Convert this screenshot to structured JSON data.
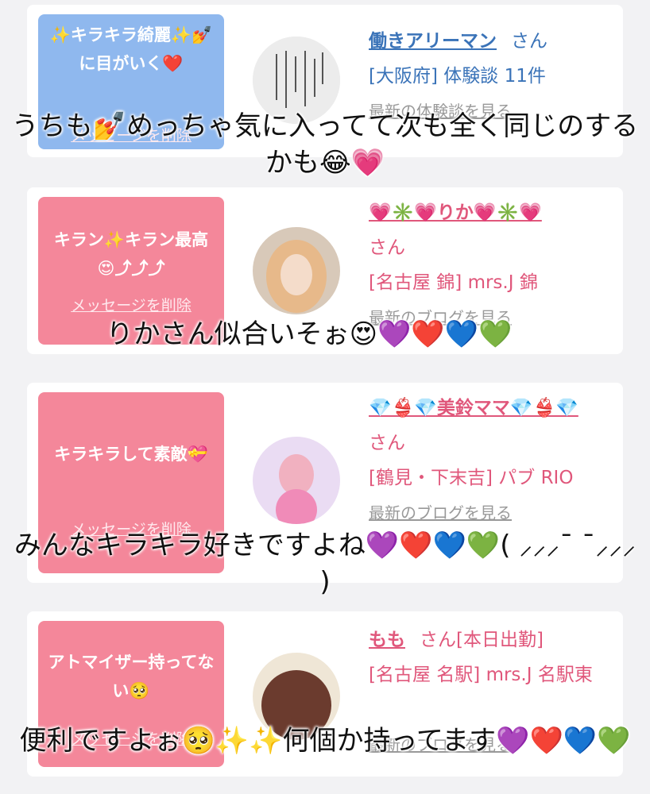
{
  "cards": [
    {
      "bubble": "✨キラキラ綺麗✨💅に目がいく❤️",
      "delete_label": "メッセージを削除",
      "name": "働きアリーマン",
      "san": "さん",
      "meta": "[大阪府] 体験談 11件",
      "blog": "最新の体験談を見る",
      "accent": "#8fb8ee"
    },
    {
      "bubble": "キラン✨キラン最高😍⤴⤴⤴",
      "delete_label": "メッセージを削除",
      "name": "💗✳️💗りか💗✳️💗",
      "san": "さん",
      "meta": "[名古屋 錦] mrs.J 錦",
      "blog": "最新のブログを見る",
      "accent": "#f4879a"
    },
    {
      "bubble": "キラキラして素敵💝",
      "delete_label": "メッセージを削除",
      "name": "💎👙💎美鈴ママ💎👙💎",
      "san": "さん",
      "meta": "[鶴見・下末吉] パブ RIO",
      "blog": "最新のブログを見る",
      "accent": "#f4879a"
    },
    {
      "bubble": "アトマイザー持ってない🥺",
      "delete_label": "メッセージを削除",
      "name": "もも",
      "san": "さん[本日出勤]",
      "meta": "[名古屋 名駅] mrs.J 名駅東",
      "blog": "最新のブログを見る",
      "accent": "#f4879a"
    }
  ],
  "captions": [
    "うちも💅めっちゃ気に入ってて次も全く同じのするかも😂💗",
    "りかさん似合いそぉ😍💜❤️💙💚",
    "みんなキラキラ好きですよね💜❤️💙💚( ⸝⸝⸝¯ ¯⸝⸝⸝ )",
    "便利ですよぉ🥺✨✨何個か持ってます💜❤️💙💚"
  ]
}
